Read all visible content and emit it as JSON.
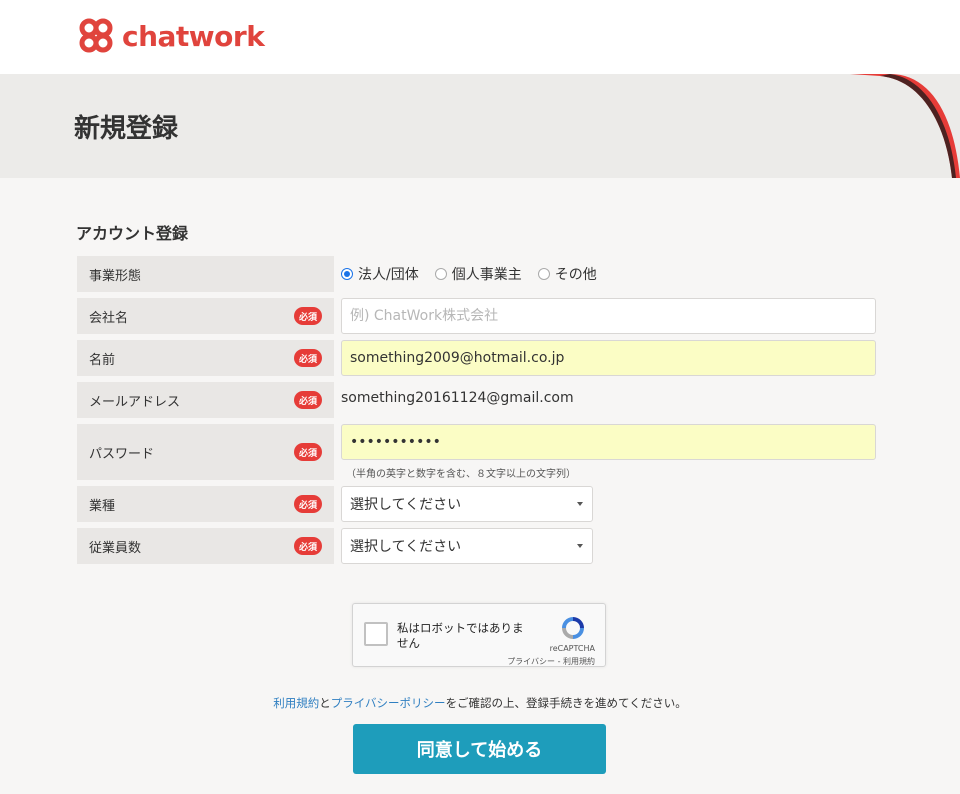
{
  "brand": {
    "name": "chatwork",
    "color": "#e0443d"
  },
  "page": {
    "title": "新規登録"
  },
  "section": {
    "title": "アカウント登録"
  },
  "form": {
    "business_type": {
      "label": "事業形態",
      "options": [
        "法人/団体",
        "個人事業主",
        "その他"
      ],
      "selected": "法人/団体"
    },
    "company": {
      "label": "会社名",
      "required": "必須",
      "value": "",
      "placeholder": "例) ChatWork株式会社"
    },
    "name": {
      "label": "名前",
      "required": "必須",
      "value": "something2009@hotmail.co.jp"
    },
    "email": {
      "label": "メールアドレス",
      "required": "必須",
      "value": "something20161124@gmail.com"
    },
    "password": {
      "label": "パスワード",
      "required": "必須",
      "value": "•••••••••••",
      "hint": "（半角の英字と数字を含む、８文字以上の文字列）"
    },
    "industry": {
      "label": "業種",
      "required": "必須",
      "value": "選択してください"
    },
    "employees": {
      "label": "従業員数",
      "required": "必須",
      "value": "選択してください"
    }
  },
  "captcha": {
    "text": "私はロボットではありません",
    "brand": "reCAPTCHA",
    "links": "プライバシー - 利用規約"
  },
  "terms": {
    "link1": "利用規約",
    "joiner": "と",
    "link2": "プライバシーポリシー",
    "rest": "をご確認の上、登録手続きを進めてください。"
  },
  "submit": {
    "label": "同意して始める",
    "color": "#1e9dbb"
  },
  "icons": {
    "logo": "chatwork-flower-icon",
    "captcha": "recaptcha-logo-icon",
    "select": "caret-down-icon"
  }
}
